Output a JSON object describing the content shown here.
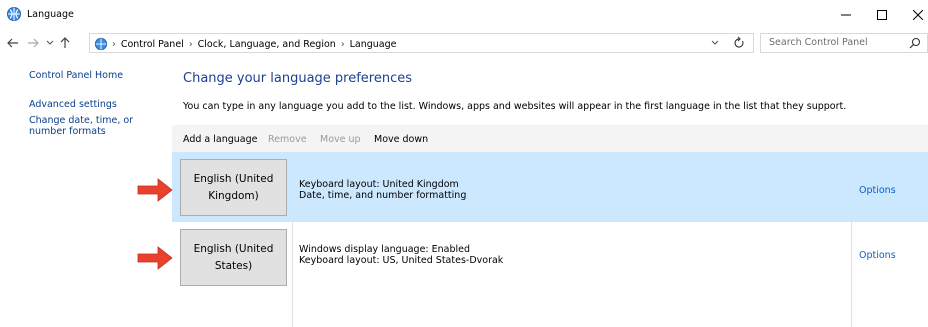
{
  "window": {
    "title": "Language",
    "minimize_icon": "minimize-icon",
    "maximize_icon": "maximize-icon",
    "close_icon": "close-icon"
  },
  "address": {
    "breadcrumbs": [
      "Control Panel",
      "Clock, Language, and Region",
      "Language"
    ],
    "search_placeholder": "Search Control Panel"
  },
  "sidebar": {
    "items": [
      {
        "label": "Control Panel Home"
      },
      {
        "label": "Advanced settings"
      },
      {
        "label": "Change date, time, or number formats"
      }
    ]
  },
  "main": {
    "title": "Change your language preferences",
    "description": "You can type in any language you add to the list. Windows, apps and websites will appear in the first language in the list that they support."
  },
  "toolbar": {
    "add_language": "Add a language",
    "remove": "Remove",
    "move_up": "Move up",
    "move_down": "Move down",
    "enabled": {
      "add_language": true,
      "remove": false,
      "move_up": false,
      "move_down": true
    }
  },
  "languages": [
    {
      "name": "English (United Kingdom)",
      "details": [
        "Keyboard layout: United Kingdom",
        "Date, time, and number formatting"
      ],
      "options_label": "Options",
      "selected": true
    },
    {
      "name": "English (United States)",
      "details": [
        "Windows display language: Enabled",
        "Keyboard layout: US, United States-Dvorak"
      ],
      "options_label": "Options",
      "selected": false
    }
  ],
  "colors": {
    "selected_row": "#cce8ff",
    "link": "#0b3f8c",
    "title": "#1e3f8f",
    "annotation_arrow": "#e8412c"
  }
}
